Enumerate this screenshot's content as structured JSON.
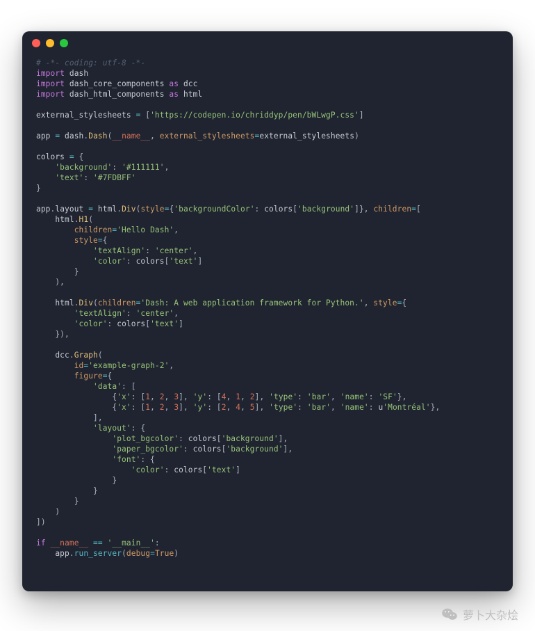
{
  "watermark": {
    "label": "萝卜大杂烩"
  },
  "code": {
    "comment_coding": "# -*- coding: utf-8 -*-",
    "import1_kw": "import",
    "import1_mod": "dash",
    "import2_kw": "import",
    "import2_mod": "dash_core_components",
    "import2_as": "as",
    "import2_alias": "dcc",
    "import3_kw": "import",
    "import3_mod": "dash_html_components",
    "import3_as": "as",
    "import3_alias": "html",
    "ext_var": "external_stylesheets",
    "ext_val": "'https://codepen.io/chriddyp/pen/bWLwgP.css'",
    "app_var": "app",
    "dash_mod": "dash",
    "dash_cls": "Dash",
    "name_d": "__name__",
    "ext_kw": "external_stylesheets",
    "ext_ref": "external_stylesheets",
    "colors_var": "colors",
    "bg_key": "'background'",
    "bg_val": "'#111111'",
    "text_key": "'text'",
    "text_val": "'#7FDBFF'",
    "layout_attr": "layout",
    "html_mod": "html",
    "div_cls": "Div",
    "style_kw": "style",
    "bgColor_key": "'backgroundColor'",
    "colors_ref": "colors",
    "bg_idx": "'background'",
    "children_kw": "children",
    "h1_cls": "H1",
    "hello": "'Hello Dash'",
    "textAlign_key": "'textAlign'",
    "center_val": "'center'",
    "color_key": "'color'",
    "text_idx": "'text'",
    "div2_text": "'Dash: A web application framework for Python.'",
    "dcc_mod": "dcc",
    "graph_cls": "Graph",
    "id_kw": "id",
    "graph_id": "'example-graph-2'",
    "figure_kw": "figure",
    "data_key": "'data'",
    "x_key": "'x'",
    "y_key": "'y'",
    "n1": "1",
    "n2": "2",
    "n3": "3",
    "n4": "4",
    "n5": "5",
    "type_key": "'type'",
    "bar_val": "'bar'",
    "name_key": "'name'",
    "sf_val": "'SF'",
    "mtl_u": "u",
    "mtl_val": "'Montréal'",
    "layout_key": "'layout'",
    "plot_bg": "'plot_bgcolor'",
    "paper_bg": "'paper_bgcolor'",
    "font_key": "'font'",
    "if_kw": "if",
    "main_d": "'__main__'",
    "run_srv": "run_server",
    "debug_kw": "debug",
    "true_v": "True"
  }
}
